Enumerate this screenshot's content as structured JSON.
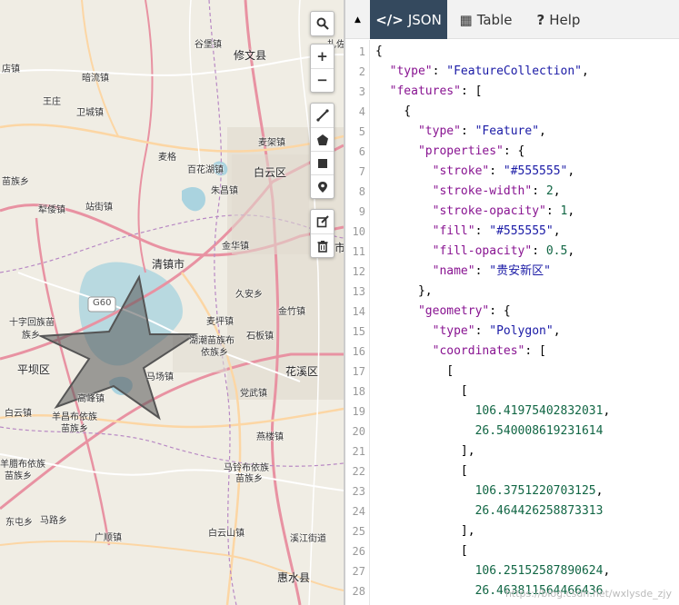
{
  "map": {
    "places": [
      {
        "label": "谷堡镇",
        "big": false
      },
      {
        "label": "修文县",
        "big": true
      },
      {
        "label": "扎佐镇",
        "big": false
      },
      {
        "label": "店镇",
        "big": false
      },
      {
        "label": "暗流镇",
        "big": false
      },
      {
        "label": "王庄",
        "big": false
      },
      {
        "label": "卫城镇",
        "big": false
      },
      {
        "label": "麦架镇",
        "big": false
      },
      {
        "label": "麦格",
        "big": false
      },
      {
        "label": "百花湖镇",
        "big": false
      },
      {
        "label": "白云区",
        "big": true
      },
      {
        "label": "苗族乡",
        "big": false
      },
      {
        "label": "朱昌镇",
        "big": false
      },
      {
        "label": "犁倭镇",
        "big": false
      },
      {
        "label": "站街镇",
        "big": false
      },
      {
        "label": "金华镇",
        "big": false
      },
      {
        "label": "清镇市",
        "big": true
      },
      {
        "label": "久安乡",
        "big": false
      },
      {
        "label": "十字回族苗",
        "big": false
      },
      {
        "label": "族乡",
        "big": false
      },
      {
        "label": "麦坪镇",
        "big": false
      },
      {
        "label": "金竹镇",
        "big": false
      },
      {
        "label": "湖潮苗族布",
        "big": false
      },
      {
        "label": "依族乡",
        "big": false
      },
      {
        "label": "石板镇",
        "big": false
      },
      {
        "label": "平坝区",
        "big": true
      },
      {
        "label": "马场镇",
        "big": false
      },
      {
        "label": "花溪区",
        "big": true
      },
      {
        "label": "高峰镇",
        "big": false
      },
      {
        "label": "党武镇",
        "big": false
      },
      {
        "label": "白云镇",
        "big": false
      },
      {
        "label": "羊昌布依族",
        "big": false
      },
      {
        "label": "苗族乡",
        "big": false
      },
      {
        "label": "燕楼镇",
        "big": false
      },
      {
        "label": "羊腊布依族",
        "big": false
      },
      {
        "label": "苗族乡",
        "big": false
      },
      {
        "label": "马铃布依族",
        "big": false
      },
      {
        "label": "苗族乡",
        "big": false
      },
      {
        "label": "东屯乡",
        "big": false
      },
      {
        "label": "马路乡",
        "big": false
      },
      {
        "label": "广顺镇",
        "big": false
      },
      {
        "label": "白云山镇",
        "big": false
      },
      {
        "label": "溪江街道",
        "big": false
      },
      {
        "label": "惠水县",
        "big": true
      },
      {
        "label": "市",
        "big": true
      }
    ],
    "highway_shield": "G60",
    "controls": {
      "search_icon": "search-icon",
      "zoom_in": "+",
      "zoom_out": "−"
    }
  },
  "panel": {
    "collapse_glyph": "▲",
    "tabs": [
      {
        "icon": "</>",
        "label": "JSON",
        "active": true
      },
      {
        "icon": "▦",
        "label": "Table",
        "active": false
      },
      {
        "icon": "?",
        "label": "Help",
        "active": false
      }
    ],
    "lines": [
      {
        "n": "1",
        "t": [
          [
            "p",
            "{"
          ]
        ]
      },
      {
        "n": "2",
        "t": [
          [
            "p",
            "  "
          ],
          [
            "k",
            "\"type\""
          ],
          [
            "p",
            ": "
          ],
          [
            "s",
            "\"FeatureCollection\""
          ],
          [
            "p",
            ","
          ]
        ]
      },
      {
        "n": "3",
        "t": [
          [
            "p",
            "  "
          ],
          [
            "k",
            "\"features\""
          ],
          [
            "p",
            ": ["
          ]
        ]
      },
      {
        "n": "4",
        "t": [
          [
            "p",
            "    {"
          ]
        ]
      },
      {
        "n": "5",
        "t": [
          [
            "p",
            "      "
          ],
          [
            "k",
            "\"type\""
          ],
          [
            "p",
            ": "
          ],
          [
            "s",
            "\"Feature\""
          ],
          [
            "p",
            ","
          ]
        ]
      },
      {
        "n": "6",
        "t": [
          [
            "p",
            "      "
          ],
          [
            "k",
            "\"properties\""
          ],
          [
            "p",
            ": {"
          ]
        ]
      },
      {
        "n": "7",
        "t": [
          [
            "p",
            "        "
          ],
          [
            "k",
            "\"stroke\""
          ],
          [
            "p",
            ": "
          ],
          [
            "s",
            "\"#555555\""
          ],
          [
            "p",
            ","
          ]
        ]
      },
      {
        "n": "8",
        "t": [
          [
            "p",
            "        "
          ],
          [
            "k",
            "\"stroke-width\""
          ],
          [
            "p",
            ": "
          ],
          [
            "n",
            "2"
          ],
          [
            "p",
            ","
          ]
        ]
      },
      {
        "n": "9",
        "t": [
          [
            "p",
            "        "
          ],
          [
            "k",
            "\"stroke-opacity\""
          ],
          [
            "p",
            ": "
          ],
          [
            "n",
            "1"
          ],
          [
            "p",
            ","
          ]
        ]
      },
      {
        "n": "10",
        "t": [
          [
            "p",
            "        "
          ],
          [
            "k",
            "\"fill\""
          ],
          [
            "p",
            ": "
          ],
          [
            "s",
            "\"#555555\""
          ],
          [
            "p",
            ","
          ]
        ]
      },
      {
        "n": "11",
        "t": [
          [
            "p",
            "        "
          ],
          [
            "k",
            "\"fill-opacity\""
          ],
          [
            "p",
            ": "
          ],
          [
            "n",
            "0.5"
          ],
          [
            "p",
            ","
          ]
        ]
      },
      {
        "n": "12",
        "t": [
          [
            "p",
            "        "
          ],
          [
            "k",
            "\"name\""
          ],
          [
            "p",
            ": "
          ],
          [
            "s",
            "\"贵安新区\""
          ]
        ]
      },
      {
        "n": "13",
        "t": [
          [
            "p",
            "      },"
          ]
        ]
      },
      {
        "n": "14",
        "t": [
          [
            "p",
            "      "
          ],
          [
            "k",
            "\"geometry\""
          ],
          [
            "p",
            ": {"
          ]
        ]
      },
      {
        "n": "15",
        "t": [
          [
            "p",
            "        "
          ],
          [
            "k",
            "\"type\""
          ],
          [
            "p",
            ": "
          ],
          [
            "s",
            "\"Polygon\""
          ],
          [
            "p",
            ","
          ]
        ]
      },
      {
        "n": "16",
        "t": [
          [
            "p",
            "        "
          ],
          [
            "k",
            "\"coordinates\""
          ],
          [
            "p",
            ": ["
          ]
        ]
      },
      {
        "n": "17",
        "t": [
          [
            "p",
            "          ["
          ]
        ]
      },
      {
        "n": "18",
        "t": [
          [
            "p",
            "            ["
          ]
        ]
      },
      {
        "n": "19",
        "t": [
          [
            "p",
            "              "
          ],
          [
            "n",
            "106.41975402832031"
          ],
          [
            "p",
            ","
          ]
        ]
      },
      {
        "n": "20",
        "t": [
          [
            "p",
            "              "
          ],
          [
            "n",
            "26.540008619231614"
          ]
        ]
      },
      {
        "n": "21",
        "t": [
          [
            "p",
            "            ],"
          ]
        ]
      },
      {
        "n": "22",
        "t": [
          [
            "p",
            "            ["
          ]
        ]
      },
      {
        "n": "23",
        "t": [
          [
            "p",
            "              "
          ],
          [
            "n",
            "106.3751220703125"
          ],
          [
            "p",
            ","
          ]
        ]
      },
      {
        "n": "24",
        "t": [
          [
            "p",
            "              "
          ],
          [
            "n",
            "26.464426258873313"
          ]
        ]
      },
      {
        "n": "25",
        "t": [
          [
            "p",
            "            ],"
          ]
        ]
      },
      {
        "n": "26",
        "t": [
          [
            "p",
            "            ["
          ]
        ]
      },
      {
        "n": "27",
        "t": [
          [
            "p",
            "              "
          ],
          [
            "n",
            "106.25152587890624"
          ],
          [
            "p",
            ","
          ]
        ]
      },
      {
        "n": "28",
        "t": [
          [
            "p",
            "              "
          ],
          [
            "n",
            "26.463811564466436"
          ]
        ]
      }
    ],
    "watermark": "https://blog.csdn.net/wxlysde_zjy"
  }
}
